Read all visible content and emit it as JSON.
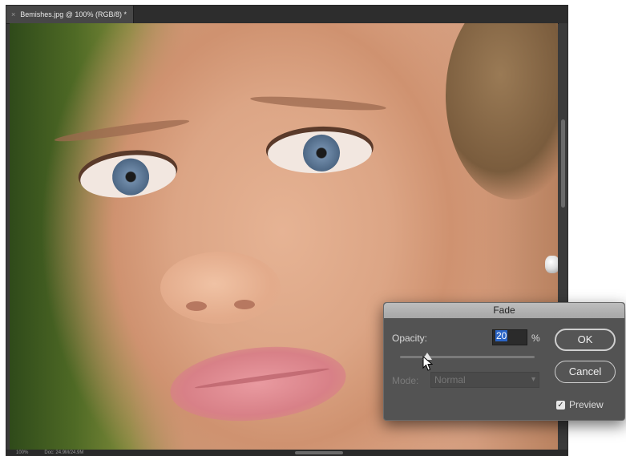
{
  "document": {
    "tab_close": "×",
    "tab_title": "Bemishes.jpg @ 100% (RGB/8) *",
    "status": {
      "zoom": "100%",
      "doc_info": "Doc: 24.9M/24.9M"
    }
  },
  "dialog": {
    "title": "Fade",
    "opacity_label": "Opacity:",
    "opacity_value": "20",
    "percent_label": "%",
    "opacity_slider_percent": 20,
    "mode_label": "Mode:",
    "mode_value": "Normal",
    "mode_disabled": true,
    "ok_label": "OK",
    "cancel_label": "Cancel",
    "preview_checked": true,
    "preview_check_glyph": "✓",
    "preview_label": "Preview"
  },
  "icons": {
    "tab_close": "close-icon",
    "mode_dropdown": "chevron-down-icon",
    "cursor": "pointer-cursor-icon",
    "preview_checkbox": "checkbox-icon"
  }
}
